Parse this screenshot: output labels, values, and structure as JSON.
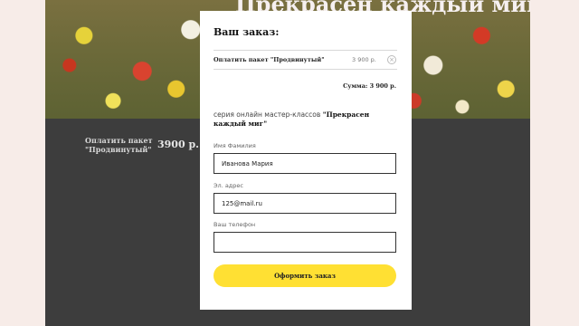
{
  "background": {
    "hero_title": "Прекрасен каждый миг",
    "product_name": "Оплатить пакет \"Продвинутый\"",
    "product_price": "3900 р."
  },
  "modal": {
    "title": "Ваш заказ:",
    "order_item": {
      "name": "Оплатить пакет \"Продвинутый\"",
      "price": "3 900 р.",
      "remove_icon": "close-icon"
    },
    "total": "Сумма: 3 900 р.",
    "series_prefix": "серия онлайн мастер-классов ",
    "series_name": "\"Прекрасен каждый миг\"",
    "fields": {
      "name": {
        "label": "Имя Фамилия",
        "value": "Иванова Мария"
      },
      "email": {
        "label": "Эл. адрес",
        "value": "125@mail.ru"
      },
      "phone": {
        "label": "Ваш телефон",
        "value": ""
      }
    },
    "submit_label": "Оформить заказ"
  },
  "colors": {
    "accent": "#ffe033",
    "backdrop": "#3d3d3d",
    "page_bg": "#f7ece8"
  }
}
